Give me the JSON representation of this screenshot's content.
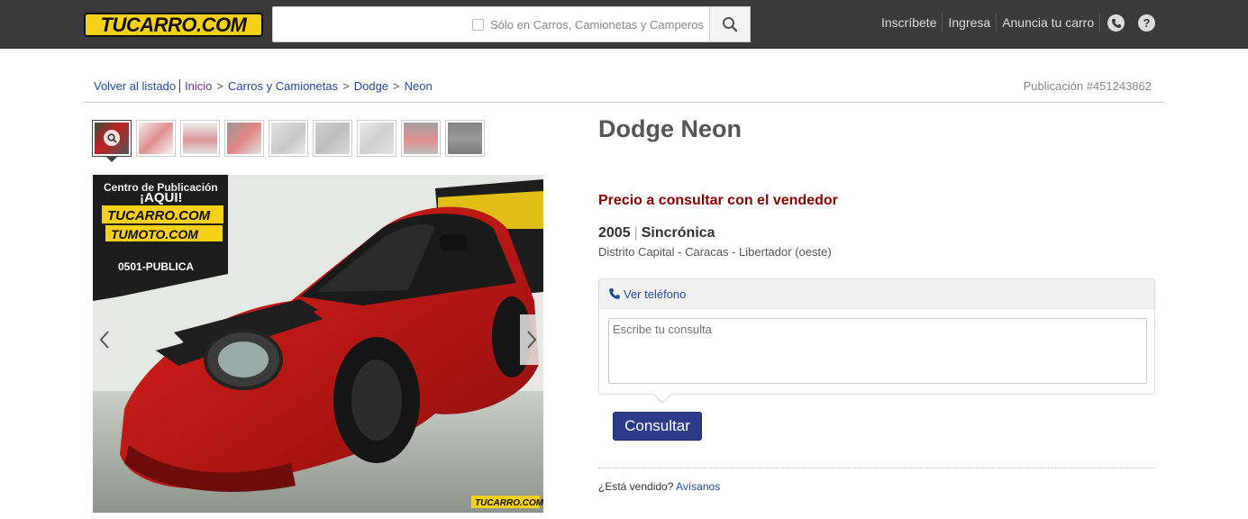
{
  "header": {
    "logo_text": "TUCARRO.COM",
    "search": {
      "value": "",
      "placeholder": "",
      "filter_label": "Sólo en Carros, Camionetas y Camperos",
      "button_icon": "search-icon"
    },
    "nav": [
      "Inscríbete",
      "Ingresa",
      "Anuncia tu carro"
    ],
    "icons": [
      "phone-icon",
      "help-icon"
    ]
  },
  "breadcrumb": {
    "back": "Volver al listado",
    "items": [
      "Inicio",
      "Carros y Camionetas",
      "Dodge",
      "Neon"
    ],
    "separator": ">"
  },
  "publication": "Publicación #451243862",
  "gallery": {
    "thumb_count": 9,
    "active_index": 0,
    "zoom_icon": "zoom-icon",
    "prev_icon": "chevron-left-icon",
    "next_icon": "chevron-right-icon",
    "photo_sign": "¡AQUI!",
    "photo_sign2": "TUCARRO.COM",
    "photo_sign3": "TUMOTO.COM",
    "photo_sign4": "Centro de Publicación",
    "photo_sign5": "0501-PUBLICA",
    "photo_watermark": "TUCARRO.COM"
  },
  "listing": {
    "title": "Dodge Neon",
    "price": "Precio a consultar con el vendedor",
    "year": "2005",
    "transmission": "Sincrónica",
    "location": "Distrito Capital - Caracas - Libertador (oeste)"
  },
  "contact": {
    "phone_link": "Ver teléfono",
    "textarea_value": "",
    "textarea_placeholder": "Escribe tu consulta",
    "submit": "Consultar"
  },
  "sold": {
    "question": "¿Está vendido?",
    "link": "Avísanos"
  },
  "colors": {
    "topbar": "#3a3a3a",
    "logo_yellow": "#f7d117",
    "price": "#8b0000",
    "link": "#244a9d",
    "button": "#2d3b8b"
  }
}
